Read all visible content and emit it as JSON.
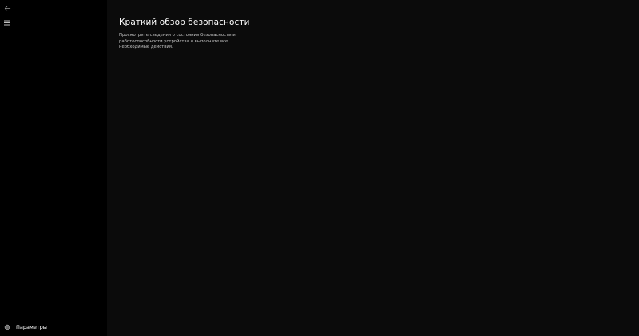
{
  "nav": {
    "back_icon": "back-arrow-icon",
    "menu_icon": "hamburger-menu-icon",
    "settings": {
      "icon": "gear-icon",
      "label": "Параметры"
    }
  },
  "main": {
    "title": "Краткий обзор безопасности",
    "description": "Просмотрите сведения о состоянии безопасности и работоспособности устройства и выполните все необходимые действия."
  },
  "colors": {
    "sidebar_bg": "#000000",
    "content_bg": "#0b0b0b",
    "text_primary": "#ffffff",
    "text_secondary": "#c8c8c8"
  }
}
